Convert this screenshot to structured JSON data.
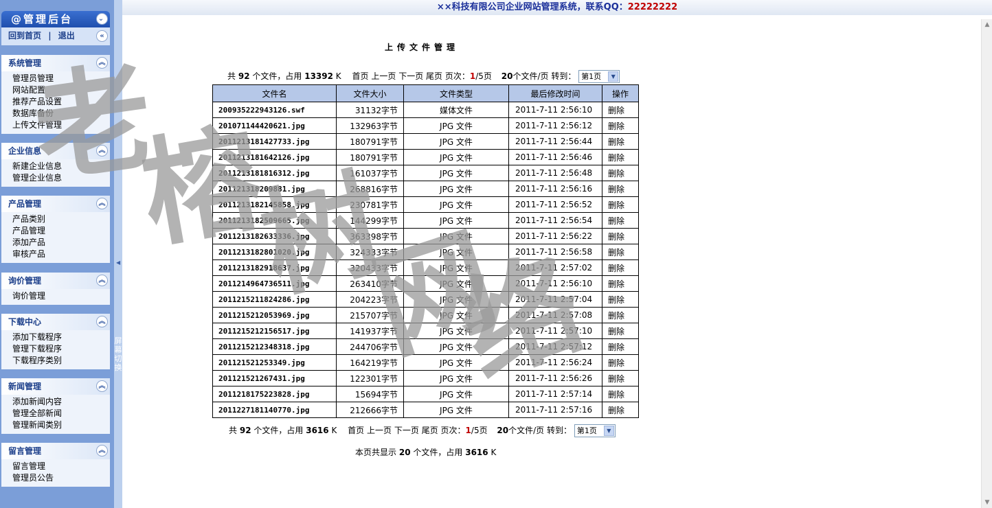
{
  "sidebar": {
    "title": "@管理后台",
    "home_link": "回到首页",
    "logout_link": "退出",
    "separator": "|",
    "groups": [
      {
        "title": "系统管理",
        "items": [
          "管理员管理",
          "网站配置",
          "推荐产品设置",
          "数据库备份",
          "上传文件管理"
        ]
      },
      {
        "title": "企业信息",
        "items": [
          "新建企业信息",
          "管理企业信息"
        ]
      },
      {
        "title": "产品管理",
        "items": [
          "产品类别",
          "产品管理",
          "添加产品",
          "审核产品"
        ]
      },
      {
        "title": "询价管理",
        "items": [
          "询价管理"
        ]
      },
      {
        "title": "下载中心",
        "items": [
          "添加下载程序",
          "管理下载程序",
          "下载程序类别"
        ]
      },
      {
        "title": "新闻管理",
        "items": [
          "添加新闻内容",
          "管理全部新闻",
          "管理新闻类别"
        ]
      },
      {
        "title": "留言管理",
        "items": [
          "留言管理",
          "管理员公告"
        ]
      }
    ],
    "splitter_label": "屏幕切换"
  },
  "topbar": {
    "title": "××科技有限公司企业网站管理系统，联系QQ：",
    "qq": "22222222"
  },
  "page": {
    "title": "上传文件管理",
    "watermark": "老榕树网络"
  },
  "pager_top": {
    "total_prefix": "共",
    "total_files": "92",
    "total_mid": "个文件，占用",
    "total_size": "13392",
    "size_unit": "K",
    "first": "首页",
    "prev": "上一页",
    "next": "下一页",
    "last": "尾页",
    "page_label": "页次：",
    "current_page": "1",
    "page_total": "/5页",
    "per_page": "20",
    "per_page_suffix": "个文件/页",
    "goto_label": "转到：",
    "goto_value": "第1页"
  },
  "pager_bottom": {
    "total_prefix": "共",
    "total_files": "92",
    "total_mid": "个文件，占用",
    "total_size": "3616",
    "size_unit": "K",
    "first": "首页",
    "prev": "上一页",
    "next": "下一页",
    "last": "尾页",
    "page_label": "页次：",
    "current_page": "1",
    "page_total": "/5页",
    "per_page": "20",
    "per_page_suffix": "个文件/页",
    "goto_label": "转到：",
    "goto_value": "第1页"
  },
  "table": {
    "headers": [
      "文件名",
      "文件大小",
      "文件类型",
      "最后修改时间",
      "操作"
    ],
    "rows": [
      [
        "200935222943126.swf",
        "31132字节",
        "媒体文件",
        "2011-7-11 2:56:10",
        "删除"
      ],
      [
        "201071144420621.jpg",
        "132963字节",
        "JPG 文件",
        "2011-7-11 2:56:12",
        "删除"
      ],
      [
        "2011213181427733.jpg",
        "180791字节",
        "JPG 文件",
        "2011-7-11 2:56:44",
        "删除"
      ],
      [
        "2011213181642126.jpg",
        "180791字节",
        "JPG 文件",
        "2011-7-11 2:56:46",
        "删除"
      ],
      [
        "2011213181816312.jpg",
        "161037字节",
        "JPG 文件",
        "2011-7-11 2:56:48",
        "删除"
      ],
      [
        "201121318209881.jpg",
        "268816字节",
        "JPG 文件",
        "2011-7-11 2:56:16",
        "删除"
      ],
      [
        "2011213182145858.jpg",
        "230781字节",
        "JPG 文件",
        "2011-7-11 2:56:52",
        "删除"
      ],
      [
        "2011213182509665.jpg",
        "144299字节",
        "JPG 文件",
        "2011-7-11 2:56:54",
        "删除"
      ],
      [
        "2011213182633336.jpg",
        "363398字节",
        "JPG 文件",
        "2011-7-11 2:56:22",
        "删除"
      ],
      [
        "2011213182801020.jpg",
        "324333字节",
        "JPG 文件",
        "2011-7-11 2:56:58",
        "删除"
      ],
      [
        "2011213182918637.jpg",
        "320433字节",
        "JPG 文件",
        "2011-7-11 2:57:02",
        "删除"
      ],
      [
        "2011214964736511.jpg",
        "263410字节",
        "JPG 文件",
        "2011-7-11 2:56:10",
        "删除"
      ],
      [
        "2011215211824286.jpg",
        "204223字节",
        "JPG 文件",
        "2011-7-11 2:57:04",
        "删除"
      ],
      [
        "2011215212053969.jpg",
        "215707字节",
        "JPG 文件",
        "2011-7-11 2:57:08",
        "删除"
      ],
      [
        "2011215212156517.jpg",
        "141937字节",
        "JPG 文件",
        "2011-7-11 2:57:10",
        "删除"
      ],
      [
        "2011215212348318.jpg",
        "244706字节",
        "JPG 文件",
        "2011-7-11 2:57:12",
        "删除"
      ],
      [
        "201121521253349.jpg",
        "164219字节",
        "JPG 文件",
        "2011-7-11 2:56:24",
        "删除"
      ],
      [
        "201121521267431.jpg",
        "122301字节",
        "JPG 文件",
        "2011-7-11 2:56:26",
        "删除"
      ],
      [
        "2011218175223828.jpg",
        "15694字节",
        "JPG 文件",
        "2011-7-11 2:57:14",
        "删除"
      ],
      [
        "2011227181140770.jpg",
        "212666字节",
        "JPG 文件",
        "2011-7-11 2:57:16",
        "删除"
      ]
    ]
  },
  "summary": {
    "prefix": "本页共显示",
    "count": "20",
    "mid": "个文件，占用",
    "size": "3616",
    "unit": "K"
  },
  "colors": {
    "sidebar_bg": "#7b9ed8",
    "header_blue": "#1f4fae",
    "table_header": "#b6c8e8",
    "accent_red": "#c00000"
  }
}
